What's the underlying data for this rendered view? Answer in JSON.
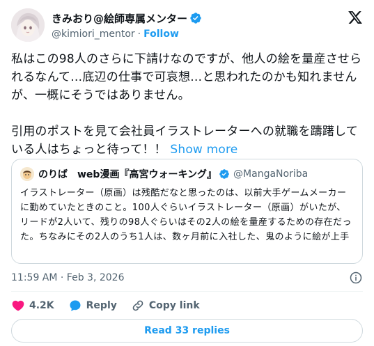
{
  "author": {
    "display_name": "きみおり@絵師専属メンター",
    "handle": "@kimiori_mentor",
    "separator": "·",
    "follow_label": "Follow"
  },
  "tweet": {
    "text": "私はこの98人のさらに下請けなのですが、他人の絵を量産させられるなんて…底辺の仕事で可哀想…と思われたのかも知れませんが、一概にそうではありません。\n\n引用のポストを見て会社員イラストレーターへの就職を躊躇している人はちょっと待って！！ ",
    "show_more_label": "Show more"
  },
  "quote": {
    "display_name": "のりば　web漫画『高宮ウォーキング』",
    "handle": "@MangaNoriba",
    "text": "イラストレーター（原画）は残酷だなと思ったのは、以前大手ゲームメーカーに勤めていたときのこと。100人ぐらいイラストレーター（原画）がいたが、リードが2人いて、残りの98人ぐらいはその2人の絵を量産するための存在だった。ちなみにその2人のうち1人は、数ヶ月前に入社した、鬼のように絵が上手"
  },
  "meta": {
    "timestamp": "11:59 AM · Feb 3, 2026"
  },
  "actions": {
    "like_count": "4.2K",
    "reply_label": "Reply",
    "copy_link_label": "Copy link"
  },
  "read_replies_label": "Read 33 replies",
  "colors": {
    "accent": "#1d9bf0",
    "like": "#f91880",
    "secondary_text": "#536471"
  },
  "icons": [
    "x-logo-icon",
    "verified-badge-icon",
    "heart-icon",
    "reply-icon",
    "link-icon",
    "info-icon"
  ]
}
